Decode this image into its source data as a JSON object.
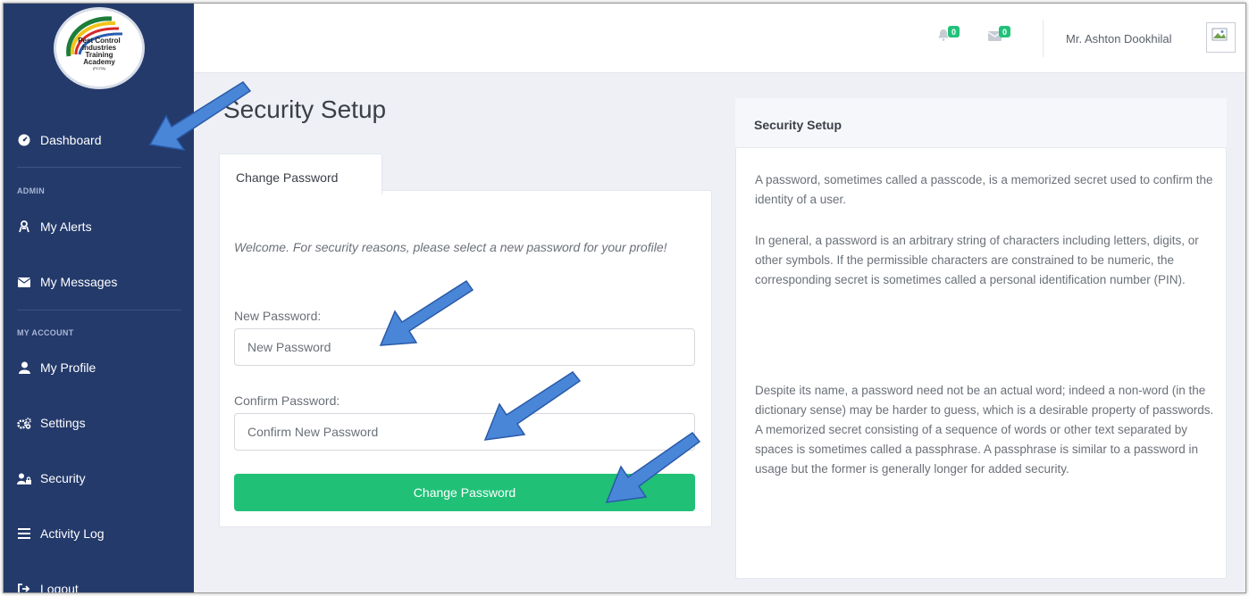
{
  "brand": {
    "logo_lines": [
      "Pest Control",
      "Industries",
      "Training",
      "Academy"
    ],
    "logo_small": "(PCITA)",
    "colors": {
      "sidebar": "#243a6b",
      "accent": "#20c077",
      "arrow": "#4a86d8"
    }
  },
  "sidebar": {
    "items": [
      {
        "label": "Dashboard",
        "icon": "dashboard-icon"
      },
      {
        "label": "My Alerts",
        "icon": "alerts-icon"
      },
      {
        "label": "My Messages",
        "icon": "envelope-icon"
      },
      {
        "label": "My Profile",
        "icon": "user-icon"
      },
      {
        "label": "Settings",
        "icon": "gears-icon"
      },
      {
        "label": "Security",
        "icon": "user-lock-icon"
      },
      {
        "label": "Activity Log",
        "icon": "list-icon"
      },
      {
        "label": "Logout",
        "icon": "logout-icon"
      }
    ],
    "sections": {
      "admin": "ADMIN",
      "my_account": "MY ACCOUNT"
    }
  },
  "topbar": {
    "notifications_count": "0",
    "messages_count": "0",
    "user_name": "Mr. Ashton Dookhilal"
  },
  "main": {
    "title": "Security Setup",
    "tab_label": "Change Password",
    "welcome_text": "Welcome. For security reasons, please select a new password for your profile!",
    "new_password_label": "New Password:",
    "new_password_placeholder": "New Password",
    "confirm_password_label": "Confirm Password:",
    "confirm_password_placeholder": "Confirm New Password",
    "submit_label": "Change Password"
  },
  "info": {
    "heading": "Security Setup",
    "paragraphs": [
      "A password, sometimes called a passcode, is a memorized secret used to confirm the identity of a user.",
      "In general, a password is an arbitrary string of characters including letters, digits, or other symbols. If the permissible characters are constrained to be numeric, the corresponding secret is sometimes called a personal identification number (PIN).",
      "Despite its name, a password need not be an actual word; indeed a non-word (in the dictionary sense) may be harder to guess, which is a desirable property of passwords. A memorized secret consisting of a sequence of words or other text separated by spaces is sometimes called a passphrase. A passphrase is similar to a password in usage but the former is generally longer for added security."
    ]
  }
}
